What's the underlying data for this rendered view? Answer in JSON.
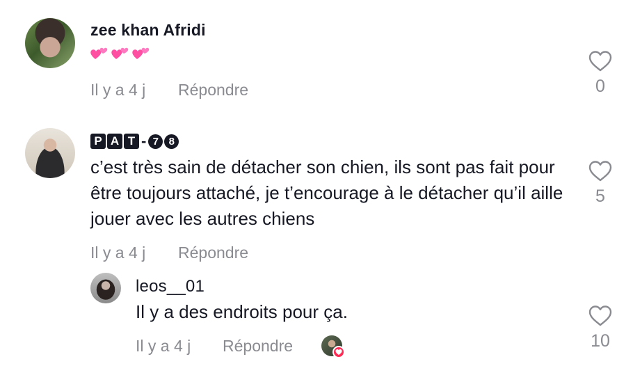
{
  "comments": [
    {
      "username": "zee khan Afridi",
      "text_emoji": "💕💕💕",
      "time": "Il y a 4 j",
      "reply": "Répondre",
      "likes": "0",
      "avatar_icon": "user-avatar-photo"
    },
    {
      "username_letters": [
        "P",
        "A",
        "T"
      ],
      "username_dash": "-",
      "username_digits": [
        "7",
        "8"
      ],
      "text": "c’est très sain de détacher son chien, ils sont pas fait pour être toujours attaché, je t’encourage à le détacher qu’il aille jouer avec les autres chiens",
      "time": "Il y a 4 j",
      "reply": "Répondre",
      "likes": "5",
      "avatar_icon": "user-avatar-photo"
    },
    {
      "username": "leos__01",
      "text": "Il y a des endroits pour ça.",
      "time": "Il y a 4 j",
      "reply": "Répondre",
      "likes": "10",
      "avatar_icon": "user-avatar-photo",
      "liked_by_creator_icon": "creator-liked-heart-icon"
    }
  ],
  "colors": {
    "text": "#161823",
    "muted": "#8a8b91",
    "accent": "#fe2c55",
    "emoji_heart": "#ff4fa3"
  }
}
